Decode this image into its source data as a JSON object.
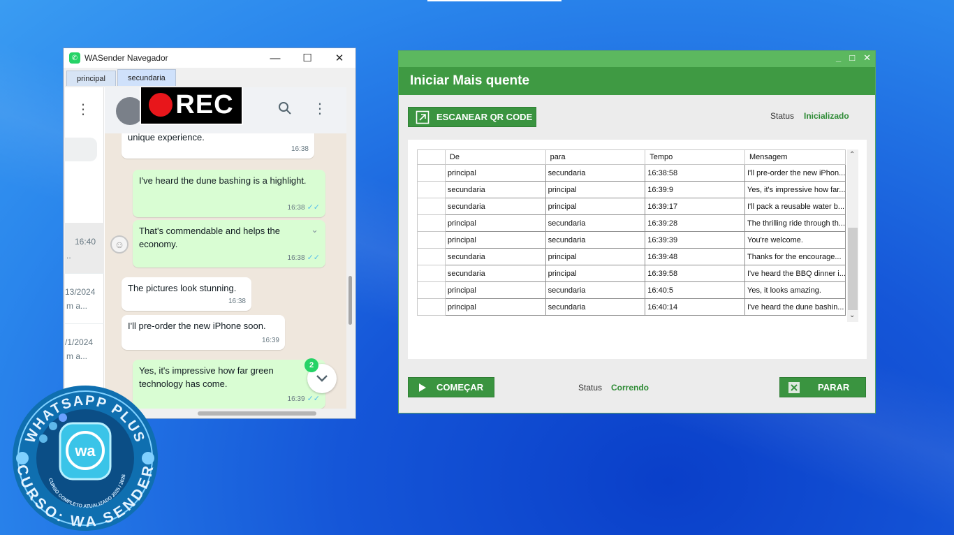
{
  "browser": {
    "title": "WASender Navegador",
    "controls": {
      "minimize": "—",
      "maximize": "☐",
      "close": "✕"
    },
    "tabs": [
      "principal",
      "secundaria"
    ],
    "active_tab": 1,
    "recording_label": "REC",
    "chat_list": [
      {
        "time": "16:40",
        "snippet": ".."
      },
      {
        "time": "13/2024",
        "snippet": "m a..."
      },
      {
        "time": "/1/2024",
        "snippet": "m a..."
      }
    ],
    "messages": [
      {
        "dir": "in",
        "text": "unique experience.",
        "time": "16:38"
      },
      {
        "dir": "out",
        "text": "I've heard the dune bashing is a highlight.",
        "time": "16:38"
      },
      {
        "dir": "out",
        "text": "That's commendable and helps the economy.",
        "time": "16:38"
      },
      {
        "dir": "in",
        "text": "The pictures look stunning.",
        "time": "16:38"
      },
      {
        "dir": "in",
        "text": "I'll pre-order the new iPhone soon.",
        "time": "16:39"
      },
      {
        "dir": "out",
        "text": "Yes, it's impressive how far green technology has come.",
        "time": "16:39"
      }
    ],
    "unread_count": "2"
  },
  "app": {
    "title": "Iniciar Mais quente",
    "controls": {
      "minimize": "_",
      "maximize": "□",
      "close": "✕"
    },
    "scan_button": "ESCANEAR QR CODE",
    "top_status_label": "Status",
    "top_status_value": "Inicializado",
    "columns": [
      "De",
      "para",
      "Tempo",
      "Mensagem"
    ],
    "rows": [
      [
        "principal",
        "secundaria",
        "16:38:58",
        "I'll pre-order the new iPhon..."
      ],
      [
        "secundaria",
        "principal",
        "16:39:9",
        "Yes, it's impressive how far..."
      ],
      [
        "secundaria",
        "principal",
        "16:39:17",
        "I'll pack a reusable water b..."
      ],
      [
        "principal",
        "secundaria",
        "16:39:28",
        "The thrilling ride through th..."
      ],
      [
        "principal",
        "secundaria",
        "16:39:39",
        "You're welcome."
      ],
      [
        "secundaria",
        "principal",
        "16:39:48",
        "Thanks for the encourage..."
      ],
      [
        "secundaria",
        "principal",
        "16:39:58",
        "I've heard the BBQ dinner i..."
      ],
      [
        "principal",
        "secundaria",
        "16:40:5",
        "Yes, it looks amazing."
      ],
      [
        "principal",
        "secundaria",
        "16:40:14",
        "I've heard the dune bashin..."
      ]
    ],
    "start_button": "COMEÇAR",
    "bottom_status_label": "Status",
    "bottom_status_value": "Correndo",
    "stop_button": "PARAR"
  },
  "logo": {
    "top_text": "WHATSAPP PLUS",
    "bottom_text": "CURSO: WA SENDER",
    "inner_text": "CURSO COMPLETO ATUALIZADO 2025 / 2026",
    "badge": "wa"
  },
  "colors": {
    "app_green": "#3f9a43",
    "titlebar_green": "#5cb85f",
    "status_green": "#2e8b35",
    "wa_out_bubble": "#d9fdd3",
    "wa_badge": "#25d366"
  }
}
